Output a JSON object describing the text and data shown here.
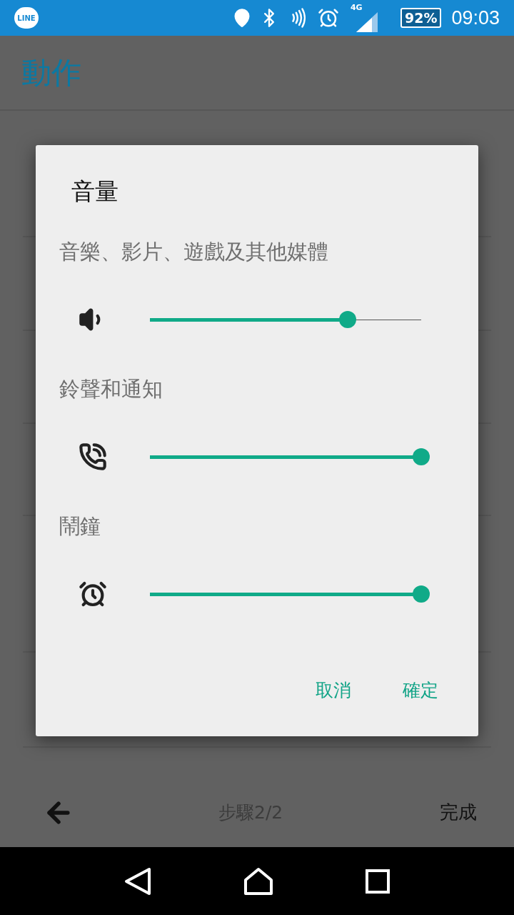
{
  "status_bar": {
    "app_icon_label": "LINE",
    "network": "4G",
    "battery": "92%",
    "time": "09:03"
  },
  "header": {
    "title": "動作"
  },
  "dialog": {
    "title": "音量",
    "sections": [
      {
        "label": "音樂、影片、遊戲及其他媒體",
        "kind": "media",
        "level": 0.73
      },
      {
        "label": "鈴聲和通知",
        "kind": "ring",
        "level": 1
      },
      {
        "label": "鬧鐘",
        "kind": "alarm",
        "level": 1
      }
    ],
    "buttons": [
      "取消",
      "確定"
    ]
  },
  "bottom_bar": {
    "step": "步驟2/2",
    "done": "完成"
  }
}
